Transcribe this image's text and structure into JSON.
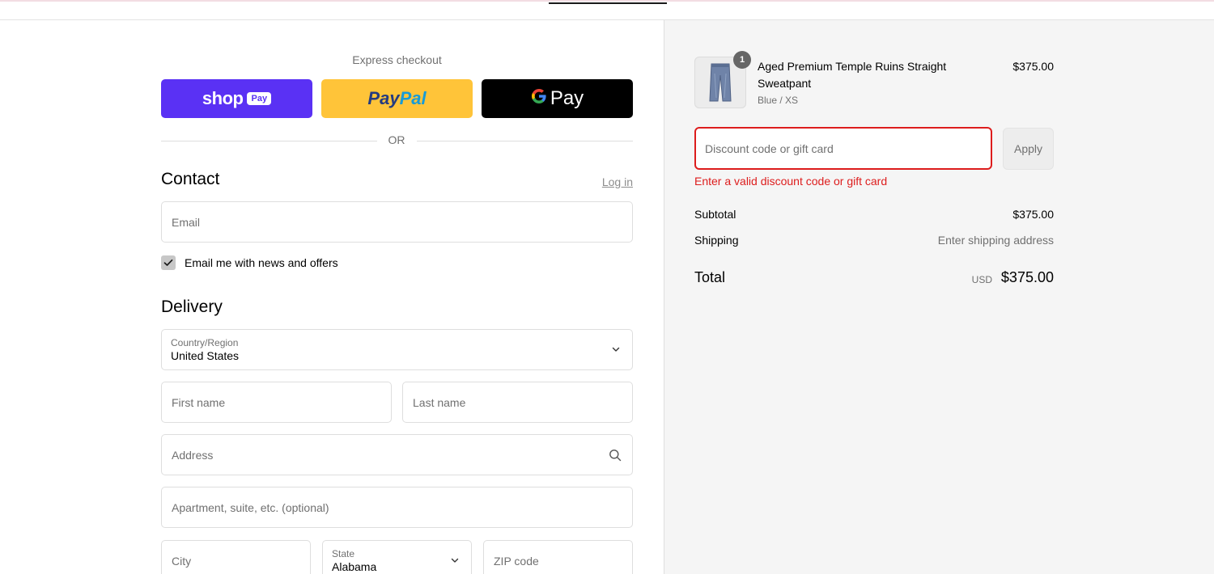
{
  "express": {
    "label": "Express checkout",
    "shop_word": "shop",
    "shop_chip": "Pay",
    "paypal_part1": "Pay",
    "paypal_part2": "Pal",
    "gpay_g": "G",
    "gpay_word": "Pay",
    "or_text": "OR"
  },
  "contact": {
    "title": "Contact",
    "login_link": "Log in",
    "email_placeholder": "Email",
    "newsletter_label": "Email me with news and offers",
    "newsletter_checked": true
  },
  "delivery": {
    "title": "Delivery",
    "country_label": "Country/Region",
    "country_value": "United States",
    "first_name_placeholder": "First name",
    "last_name_placeholder": "Last name",
    "address_placeholder": "Address",
    "apartment_placeholder": "Apartment, suite, etc. (optional)",
    "city_placeholder": "City",
    "state_label": "State",
    "state_value": "Alabama",
    "zip_placeholder": "ZIP code"
  },
  "summary": {
    "product": {
      "quantity": "1",
      "name": "Aged Premium Temple Ruins Straight Sweatpant",
      "variant": "Blue / XS",
      "price": "$375.00"
    },
    "discount_placeholder": "Discount code or gift card",
    "apply_label": "Apply",
    "error": "Enter a valid discount code or gift card",
    "subtotal_label": "Subtotal",
    "subtotal_value": "$375.00",
    "shipping_label": "Shipping",
    "shipping_value": "Enter shipping address",
    "total_label": "Total",
    "total_currency": "USD",
    "total_value": "$375.00"
  },
  "colors": {
    "shop_pay": "#5a31f4",
    "paypal": "#ffc439",
    "gpay": "#000000",
    "error": "#dd1d1d"
  }
}
